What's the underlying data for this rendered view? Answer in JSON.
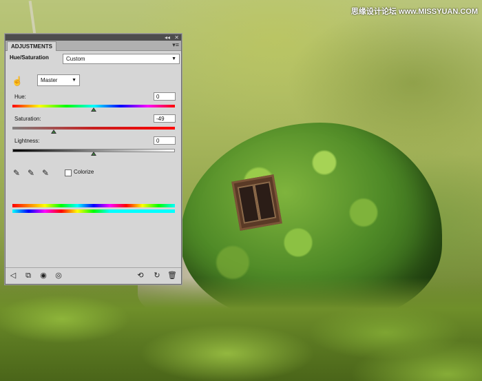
{
  "watermark": "思缘设计论坛 www.MISSYUAN.COM",
  "panel": {
    "tab_label": "ADJUSTMENTS",
    "collapse_glyph": "◂◂",
    "close_glyph": "✕",
    "menu_glyph": "▾≡",
    "preset_title": "Hue/Saturation",
    "preset_value": "Custom",
    "channel_value": "Master",
    "sliders": [
      {
        "label": "Hue:",
        "value": "0",
        "position": 0.5
      },
      {
        "label": "Saturation:",
        "value": "-49",
        "position": 0.255
      },
      {
        "label": "Lightness:",
        "value": "0",
        "position": 0.5
      }
    ],
    "colorize_label": "Colorize",
    "colorize_checked": false
  },
  "icons": {
    "on_image_adjust": "hand-icon",
    "eyedropper": "eyedropper-icon",
    "eyedropper_add": "eyedropper-plus-icon",
    "eyedropper_subtract": "eyedropper-minus-icon",
    "back": "arrow-left-icon",
    "expand": "expand-view-icon",
    "clip": "clip-to-layer-icon",
    "visibility": "eye-icon",
    "view_previous": "view-previous-icon",
    "reset": "reset-icon",
    "delete": "trash-icon"
  }
}
